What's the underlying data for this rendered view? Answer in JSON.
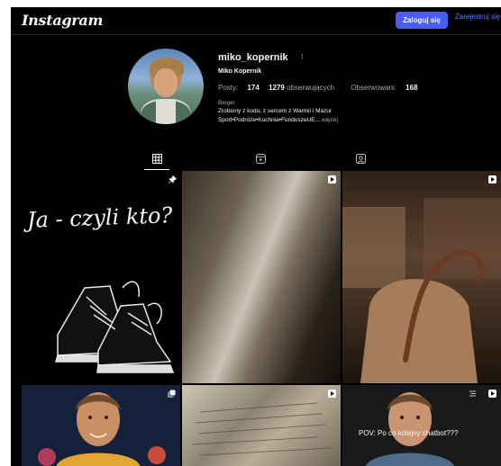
{
  "header": {
    "logo": "Instagram",
    "login_label": "Zaloguj się",
    "signup_label": "Zarejestruj się"
  },
  "profile": {
    "username": "miko_kopernik",
    "full_name": "Miko Kopernik",
    "stats": {
      "posts_label": "Posty:",
      "posts": "174",
      "followers": "1279",
      "followers_label": "obserwujących",
      "following_label": "Obserwowani:",
      "following": "168"
    },
    "category": "Bloger",
    "bio_line1": "Zrobiony z kodu, z sercem z Warmii i Mazur",
    "bio_line2": "Sport•Podróże•Kuchnia•FunduszeUE...",
    "more_label": " więcej"
  },
  "tabs": [
    {
      "name": "posts",
      "icon": "grid-icon",
      "active": true
    },
    {
      "name": "reels",
      "icon": "reels-icon",
      "active": false
    },
    {
      "name": "tagged",
      "icon": "tagged-icon",
      "active": false
    }
  ],
  "posts": [
    {
      "caption": "Ja - czyli kto?",
      "badge": "pin-icon"
    },
    {
      "badge": "reel-icon"
    },
    {
      "badge": "reel-icon"
    },
    {
      "badge": "carousel-icon"
    },
    {
      "badge": "reel-icon"
    },
    {
      "caption": "POV: Po co kolejny chatbot???",
      "badge": "reel-icon"
    }
  ],
  "colors": {
    "background": "#000000",
    "accent": "#4a5df9",
    "link": "#5a7dff",
    "text": "#f5f5f5",
    "muted": "#a8a8a8"
  }
}
